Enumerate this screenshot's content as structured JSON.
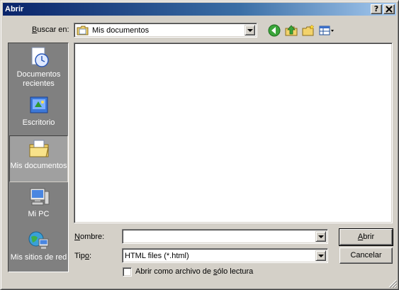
{
  "window": {
    "title": "Abrir",
    "help_button": "?",
    "close_button": "X"
  },
  "toolbar": {
    "look_in_label_pre": "B",
    "look_in_label_post": "uscar en:",
    "look_in_value": "Mis documentos",
    "back_icon": "back-icon",
    "up_icon": "up-folder-icon",
    "new_folder_icon": "new-folder-icon",
    "views_icon": "views-menu-icon"
  },
  "places": [
    {
      "label": "Documentos recientes",
      "icon": "recent-documents-icon"
    },
    {
      "label": "Escritorio",
      "icon": "desktop-icon"
    },
    {
      "label": "Mis documentos",
      "icon": "my-documents-icon",
      "selected": true
    },
    {
      "label": "Mi PC",
      "icon": "my-computer-icon"
    },
    {
      "label": "Mis sitios de red",
      "icon": "network-places-icon"
    }
  ],
  "form": {
    "filename_label_pre": "N",
    "filename_label_post": "ombre:",
    "filename_value": "",
    "filetype_label_pre": "Tip",
    "filetype_label_u": "o",
    "filetype_label_post": ":",
    "filetype_value": "HTML files (*.html)",
    "readonly_label_pre": "Abrir como archivo de ",
    "readonly_label_u": "s",
    "readonly_label_post": "ólo lectura",
    "readonly_checked": false
  },
  "buttons": {
    "open_u": "A",
    "open_rest": "brir",
    "cancel": "Cancelar"
  },
  "colors": {
    "titlebar_start": "#0a246a",
    "titlebar_end": "#a6caf0",
    "face": "#d4d0c8",
    "places_bg": "#808080"
  }
}
